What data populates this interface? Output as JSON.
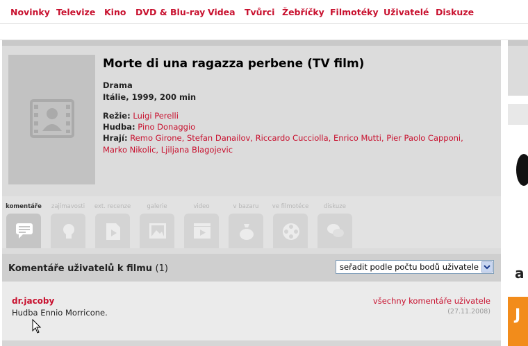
{
  "nav": {
    "items": [
      {
        "label": "Novinky"
      },
      {
        "label": "Televize"
      },
      {
        "label": "Kino"
      },
      {
        "label": "DVD & Blu-ray"
      },
      {
        "label": "Videa"
      },
      {
        "label": "Tvůrci"
      },
      {
        "label": "Žebříčky"
      },
      {
        "label": "Filmotéky"
      },
      {
        "label": "Uživatelé"
      },
      {
        "label": "Diskuze"
      }
    ]
  },
  "film": {
    "title": "Morte di una ragazza perbene (TV film)",
    "genre": "Drama",
    "origin": "Itálie, 1999, 200 min",
    "directing_label": "Režie:",
    "director": "Luigi Perelli",
    "music_label": "Hudba:",
    "composer": "Pino Donaggio",
    "cast_label": "Hrají:",
    "cast": "Remo Girone, Stefan Danailov, Riccardo Cucciolla, Enrico Mutti, Pier Paolo Capponi, Marko Nikolic, Ljiljana Blagojevic",
    "poster_icon": "film-person-icon"
  },
  "tabs": [
    {
      "label": "komentáře",
      "icon": "comment-icon",
      "active": true
    },
    {
      "label": "zajímavosti",
      "icon": "lightbulb-icon",
      "active": false
    },
    {
      "label": "ext. recenze",
      "icon": "external-review-icon",
      "active": false
    },
    {
      "label": "galerie",
      "icon": "gallery-icon",
      "active": false
    },
    {
      "label": "video",
      "icon": "video-icon",
      "active": false
    },
    {
      "label": "v bazaru",
      "icon": "money-bag-icon",
      "active": false
    },
    {
      "label": "ve filmotéce",
      "icon": "film-reel-icon",
      "active": false
    },
    {
      "label": "diskuze",
      "icon": "discussion-icon",
      "active": false
    }
  ],
  "comments": {
    "heading": "Komentáře uživatelů k filmu",
    "count": "(1)",
    "sort_value": "seřadit podle počtu bodů uživatele",
    "items": [
      {
        "user": "dr.jacoby",
        "text": "Hudba Ennio Morricone.",
        "all_link": "všechny komentáře uživatele",
        "date": "(27.11.2008)"
      }
    ]
  },
  "ad": {
    "letter_a": "a",
    "letter_j": "J"
  },
  "colors": {
    "accent": "#c8102e",
    "panel": "#dcdcdc",
    "ad_orange": "#f28c1b"
  }
}
